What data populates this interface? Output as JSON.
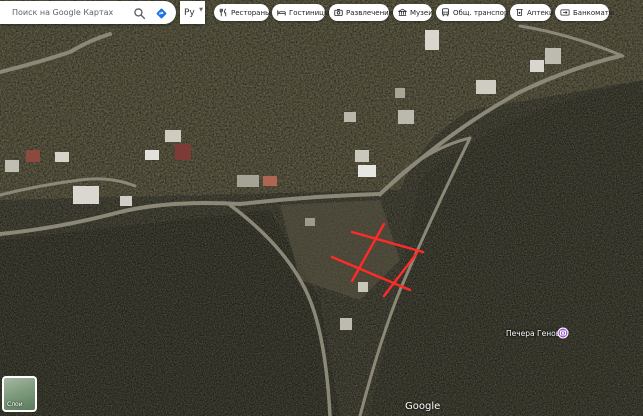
{
  "search": {
    "placeholder": "Поиск на Google Картах"
  },
  "language": {
    "value": "Ру"
  },
  "categories": [
    {
      "label": "Рестораны",
      "icon": "fork-knife-icon"
    },
    {
      "label": "Гостиницы",
      "icon": "bed-icon"
    },
    {
      "label": "Развлечения",
      "icon": "camera-icon"
    },
    {
      "label": "Музеи",
      "icon": "museum-icon"
    },
    {
      "label": "Общ. транспорт",
      "icon": "bus-icon"
    },
    {
      "label": "Аптеки",
      "icon": "pharmacy-icon"
    },
    {
      "label": "Банкоматы",
      "icon": "atm-icon"
    }
  ],
  "map": {
    "place_label": "Печера Геноват",
    "layers_label": "Слои",
    "watermark": "Google",
    "view": "satellite",
    "colors": {
      "annotation": "#ff2a2a",
      "place_pin": "#a05fd0"
    }
  }
}
